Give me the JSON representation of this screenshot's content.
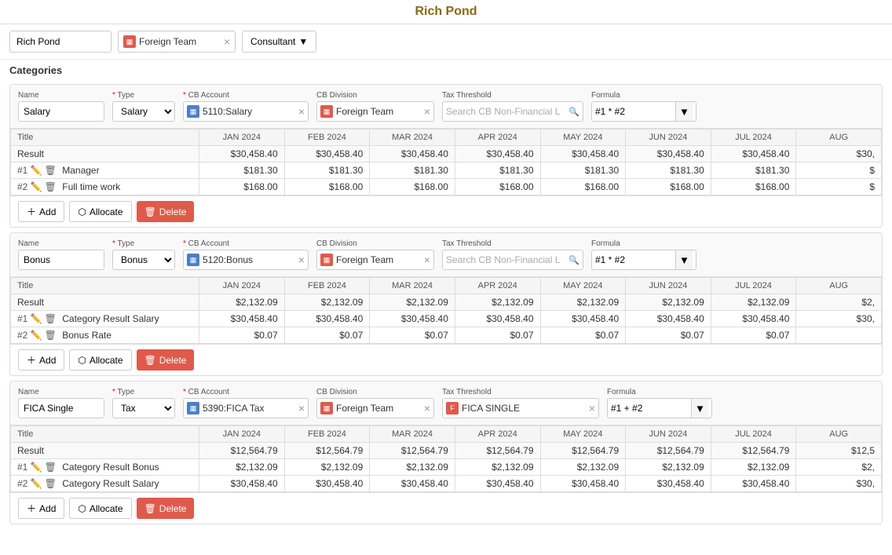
{
  "page": {
    "title": "Rich Pond"
  },
  "toolbar": {
    "person_name": "Rich Pond",
    "team_name": "Foreign Team",
    "role_label": "Consultant",
    "role_arrow": "▼"
  },
  "categories_label": "Categories",
  "sections": [
    {
      "id": "salary",
      "name_label": "Name",
      "name_value": "Salary",
      "type_label": "* Type",
      "type_value": "Salary",
      "cb_account_label": "* CB Account",
      "cb_account_value": "5110:Salary",
      "cb_division_label": "CB Division",
      "cb_division_value": "Foreign Team",
      "tax_threshold_label": "Tax Threshold",
      "tax_threshold_placeholder": "Search CB Non-Financial L",
      "formula_label": "Formula",
      "formula_value": "#1 * #2",
      "columns": [
        "Title",
        "JAN 2024",
        "FEB 2024",
        "MAR 2024",
        "APR 2024",
        "MAY 2024",
        "JUN 2024",
        "JUL 2024",
        "AUG"
      ],
      "rows": [
        {
          "type": "result",
          "label": "Result",
          "num": "",
          "values": [
            "$30,458.40",
            "$30,458.40",
            "$30,458.40",
            "$30,458.40",
            "$30,458.40",
            "$30,458.40",
            "$30,458.40",
            "$30,"
          ]
        },
        {
          "type": "data",
          "label": "Manager",
          "num": "#1",
          "values": [
            "$181.30",
            "$181.30",
            "$181.30",
            "$181.30",
            "$181.30",
            "$181.30",
            "$181.30",
            "$"
          ]
        },
        {
          "type": "data",
          "label": "Full time work",
          "num": "#2",
          "values": [
            "$168.00",
            "$168.00",
            "$168.00",
            "$168.00",
            "$168.00",
            "$168.00",
            "$168.00",
            "$"
          ]
        }
      ],
      "buttons": [
        "+ Add",
        "Allocate",
        "Delete"
      ]
    },
    {
      "id": "bonus",
      "name_label": "Name",
      "name_value": "Bonus",
      "type_label": "* Type",
      "type_value": "Bonus",
      "cb_account_label": "* CB Account",
      "cb_account_value": "5120:Bonus",
      "cb_division_label": "CB Division",
      "cb_division_value": "Foreign Team",
      "tax_threshold_label": "Tax Threshold",
      "tax_threshold_placeholder": "Search CB Non-Financial L",
      "formula_label": "Formula",
      "formula_value": "#1 * #2",
      "columns": [
        "Title",
        "JAN 2024",
        "FEB 2024",
        "MAR 2024",
        "APR 2024",
        "MAY 2024",
        "JUN 2024",
        "JUL 2024",
        "AUG"
      ],
      "rows": [
        {
          "type": "result",
          "label": "Result",
          "num": "",
          "values": [
            "$2,132.09",
            "$2,132.09",
            "$2,132.09",
            "$2,132.09",
            "$2,132.09",
            "$2,132.09",
            "$2,132.09",
            "$2,"
          ]
        },
        {
          "type": "data",
          "label": "Category Result Salary",
          "num": "#1",
          "values": [
            "$30,458.40",
            "$30,458.40",
            "$30,458.40",
            "$30,458.40",
            "$30,458.40",
            "$30,458.40",
            "$30,458.40",
            "$30,"
          ]
        },
        {
          "type": "data",
          "label": "Bonus Rate",
          "num": "#2",
          "values": [
            "$0.07",
            "$0.07",
            "$0.07",
            "$0.07",
            "$0.07",
            "$0.07",
            "$0.07",
            ""
          ]
        }
      ],
      "buttons": [
        "+ Add",
        "Allocate",
        "Delete"
      ]
    },
    {
      "id": "fica",
      "name_label": "Name",
      "name_value": "FICA Single",
      "type_label": "* Type",
      "type_value": "Tax",
      "cb_account_label": "* CB Account",
      "cb_account_value": "5390:FICA Tax",
      "cb_division_label": "CB Division",
      "cb_division_value": "Foreign Team",
      "tax_threshold_label": "Tax Threshold",
      "tax_threshold_value": "FICA SINGLE",
      "formula_label": "Formula",
      "formula_value": "#1 + #2",
      "columns": [
        "Title",
        "JAN 2024",
        "FEB 2024",
        "MAR 2024",
        "APR 2024",
        "MAY 2024",
        "JUN 2024",
        "JUL 2024",
        "AUG"
      ],
      "rows": [
        {
          "type": "result",
          "label": "Result",
          "num": "",
          "values": [
            "$12,564.79",
            "$12,564.79",
            "$12,564.79",
            "$12,564.79",
            "$12,564.79",
            "$12,564.79",
            "$12,564.79",
            "$12,5"
          ]
        },
        {
          "type": "data",
          "label": "Category Result Bonus",
          "num": "#1",
          "values": [
            "$2,132.09",
            "$2,132.09",
            "$2,132.09",
            "$2,132.09",
            "$2,132.09",
            "$2,132.09",
            "$2,132.09",
            "$2,"
          ]
        },
        {
          "type": "data",
          "label": "Category Result Salary",
          "num": "#2",
          "values": [
            "$30,458.40",
            "$30,458.40",
            "$30,458.40",
            "$30,458.40",
            "$30,458.40",
            "$30,458.40",
            "$30,458.40",
            "$30,"
          ]
        }
      ],
      "buttons": [
        "+ Add",
        "Allocate",
        "Delete"
      ]
    }
  ]
}
